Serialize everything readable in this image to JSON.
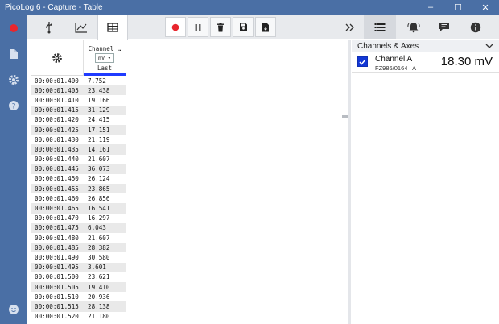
{
  "window": {
    "title": "PicoLog 6 - Capture - Table",
    "minimize": "–",
    "maximize": "☐",
    "close": "✕"
  },
  "toolbar": {
    "views": [
      "usb-icon",
      "graph-icon",
      "table-icon"
    ],
    "active_view": "table",
    "controls": [
      "record-icon",
      "pause-icon",
      "delete-icon",
      "save-icon",
      "export-icon"
    ],
    "right": [
      "expand-icon",
      "list-icon",
      "alarm-icon",
      "notes-icon",
      "info-icon"
    ]
  },
  "table": {
    "channel_name": "Channel …",
    "unit": "mV ▾",
    "column_label": "Last",
    "rows": [
      {
        "time": "00:00:01.400",
        "value": "7.752"
      },
      {
        "time": "00:00:01.405",
        "value": "23.438"
      },
      {
        "time": "00:00:01.410",
        "value": "19.166"
      },
      {
        "time": "00:00:01.415",
        "value": "31.129"
      },
      {
        "time": "00:00:01.420",
        "value": "24.415"
      },
      {
        "time": "00:00:01.425",
        "value": "17.151"
      },
      {
        "time": "00:00:01.430",
        "value": "21.119"
      },
      {
        "time": "00:00:01.435",
        "value": "14.161"
      },
      {
        "time": "00:00:01.440",
        "value": "21.607"
      },
      {
        "time": "00:00:01.445",
        "value": "36.073"
      },
      {
        "time": "00:00:01.450",
        "value": "26.124"
      },
      {
        "time": "00:00:01.455",
        "value": "23.865"
      },
      {
        "time": "00:00:01.460",
        "value": "26.856"
      },
      {
        "time": "00:00:01.465",
        "value": "16.541"
      },
      {
        "time": "00:00:01.470",
        "value": "16.297"
      },
      {
        "time": "00:00:01.475",
        "value": "6.043"
      },
      {
        "time": "00:00:01.480",
        "value": "21.607"
      },
      {
        "time": "00:00:01.485",
        "value": "28.382"
      },
      {
        "time": "00:00:01.490",
        "value": "30.580"
      },
      {
        "time": "00:00:01.495",
        "value": "3.601"
      },
      {
        "time": "00:00:01.500",
        "value": "23.621"
      },
      {
        "time": "00:00:01.505",
        "value": "19.410"
      },
      {
        "time": "00:00:01.510",
        "value": "20.936"
      },
      {
        "time": "00:00:01.515",
        "value": "28.138"
      },
      {
        "time": "00:00:01.520",
        "value": "21.180"
      }
    ]
  },
  "panel": {
    "title": "Channels & Axes",
    "channel": {
      "name": "Channel A",
      "device": "FZ986/0164 | A",
      "value": "18.30 mV",
      "checked": true
    }
  },
  "colors": {
    "accent": "#4a6fa5",
    "record": "#e8262d",
    "checkbox": "#1237d6",
    "channel_bar": "#1f3bff"
  }
}
